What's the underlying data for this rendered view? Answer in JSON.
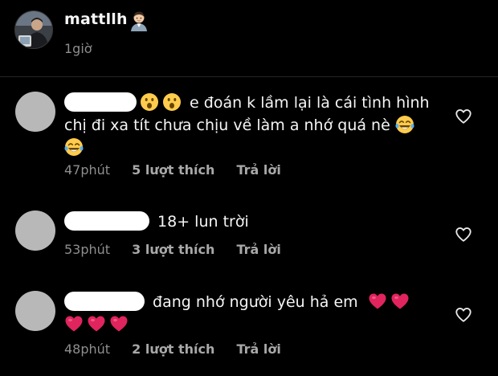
{
  "post": {
    "author": "mattllh",
    "author_emoji": "man-technologist-emoji-icon",
    "time": "1giờ"
  },
  "colors": {
    "background": "#000000",
    "text": "#f5f5f5",
    "meta": "#8e8e8e",
    "avatar_placeholder": "#b8b8b8",
    "heart_red": "#e0245e"
  },
  "comments": [
    {
      "text": "e đoán k lầm lại là cái tình hình chị đi xa tít chưa chịu về làm a nhớ quá nè",
      "line1": "e đoán k lầm lại là cái tình hình",
      "line2": "chị đi xa tít chưa chịu về làm a nhớ quá nè",
      "time": "47phút",
      "likes": "5 lượt thích",
      "reply": "Trả lời",
      "emojis": [
        "surprised-face-emoji",
        "surprised-face-emoji",
        "crying-laughing-emoji",
        "crying-laughing-emoji"
      ]
    },
    {
      "text": "18+ lun trời",
      "time": "53phút",
      "likes": "3 lượt thích",
      "reply": "Trả lời",
      "emojis": []
    },
    {
      "text": "đang nhớ người yêu hả em",
      "time": "48phút",
      "likes": "2 lượt thích",
      "reply": "Trả lời",
      "emojis": [
        "red-heart-emoji",
        "red-heart-emoji",
        "red-heart-emoji",
        "red-heart-emoji",
        "red-heart-emoji"
      ]
    }
  ]
}
